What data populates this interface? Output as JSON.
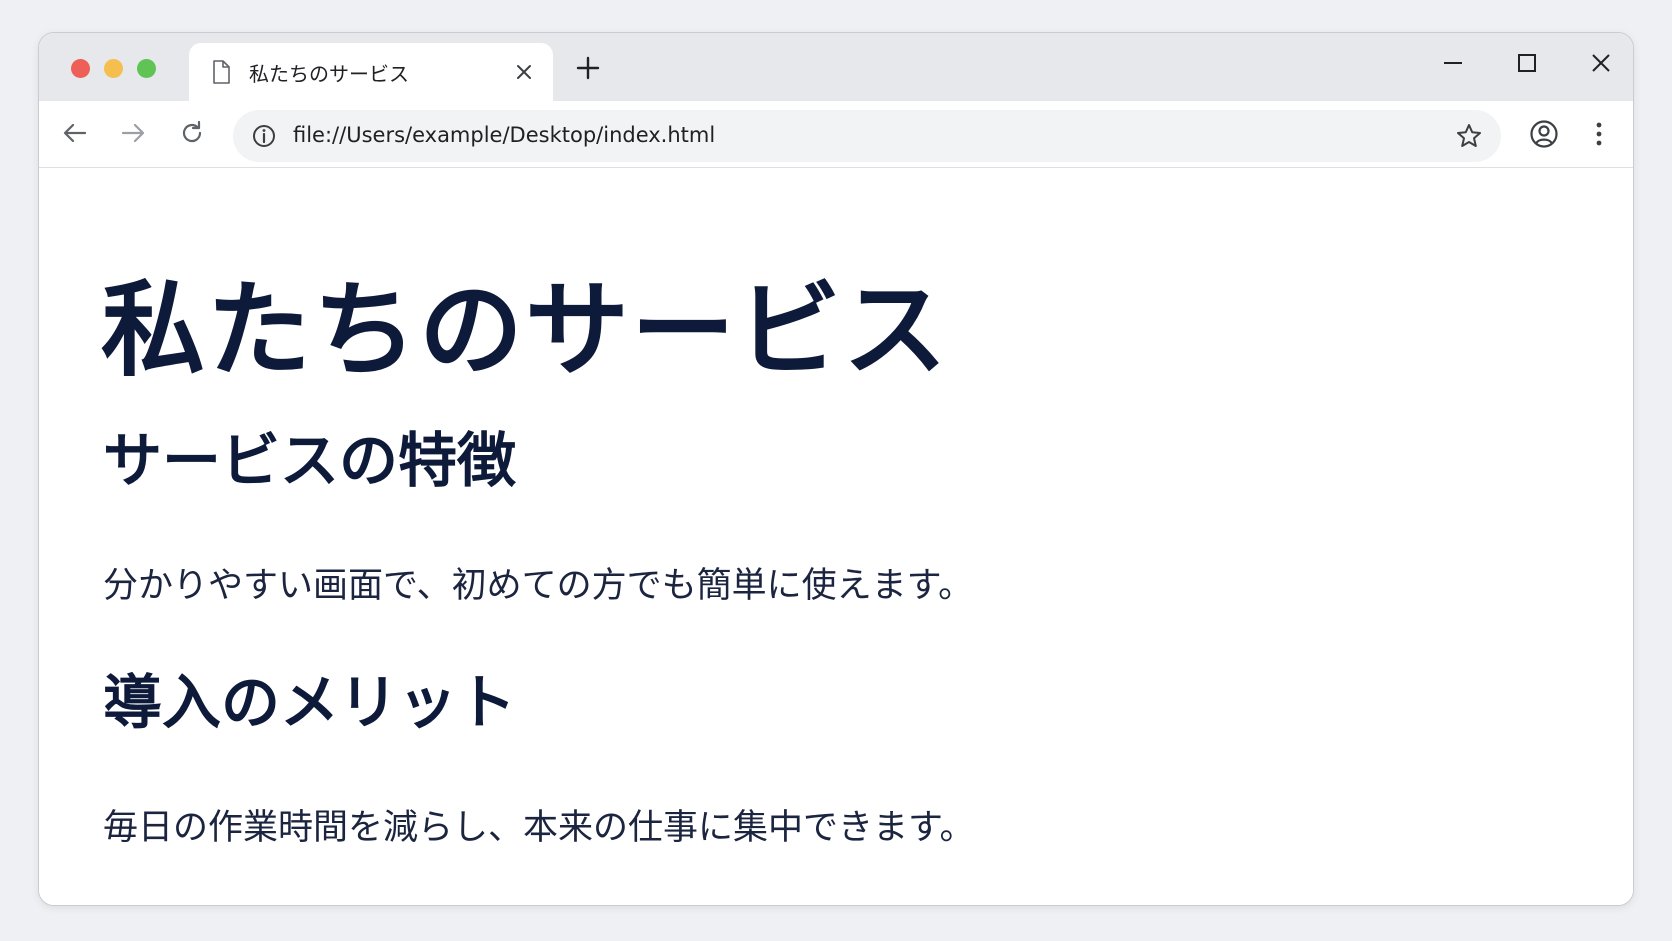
{
  "browser": {
    "tab": {
      "title": "私たちのサービス"
    },
    "address_bar": {
      "url": "file://Users/example/Desktop/index.html"
    }
  },
  "page": {
    "heading": "私たちのサービス",
    "sections": [
      {
        "title": "サービスの特徴",
        "text": "分かりやすい画面で、初めての方でも簡単に使えます。"
      },
      {
        "title": "導入のメリット",
        "text": "毎日の作業時間を減らし、本来の仕事に集中できます。"
      }
    ]
  },
  "colors": {
    "heading": "#0e1a3a",
    "close_dot": "#ee5f57",
    "minimize_dot": "#f4bf4f",
    "zoom_dot": "#5fc454"
  },
  "icons": [
    "document-icon",
    "close-icon",
    "plus-icon",
    "minimize-icon",
    "maximize-icon",
    "window-close-icon",
    "back-arrow-icon",
    "forward-arrow-icon",
    "reload-icon",
    "info-icon",
    "star-icon",
    "profile-icon",
    "more-menu-icon"
  ]
}
